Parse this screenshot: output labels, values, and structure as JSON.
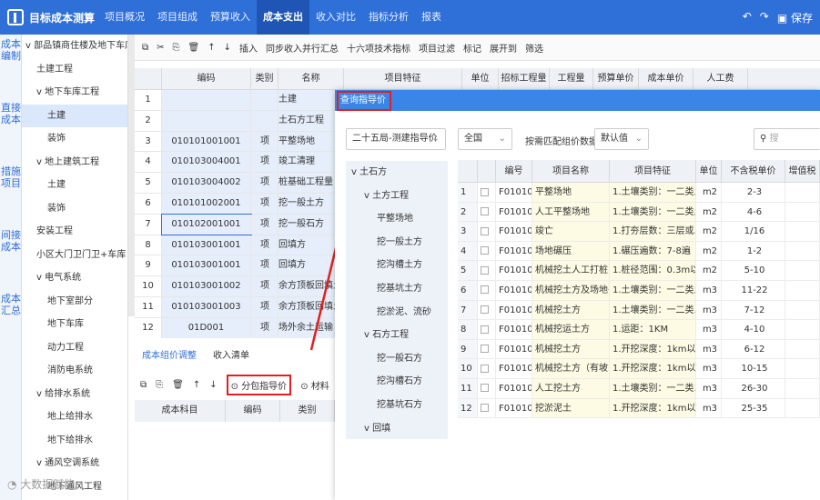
{
  "app": {
    "title": "目标成本测算"
  },
  "menu": [
    "项目概况",
    "项目组成",
    "预算收入",
    "成本支出",
    "收入对比",
    "指标分析",
    "报表"
  ],
  "menu_active": 3,
  "top_icons": [
    "undo-icon",
    "redo-icon",
    "save-icon"
  ],
  "save_label": "保存",
  "side_tabs": [
    "成本编制",
    "直接成本",
    "措施项目",
    "间接成本",
    "成本汇总"
  ],
  "tree": [
    {
      "label": "部品镇商住楼及地下车库",
      "indent": 0,
      "caret": "v"
    },
    {
      "label": "土建工程",
      "indent": 1,
      "caret": ""
    },
    {
      "label": "地下车库工程",
      "indent": 1,
      "caret": "v"
    },
    {
      "label": "土建",
      "indent": 2,
      "caret": "",
      "sel": true
    },
    {
      "label": "装饰",
      "indent": 2,
      "caret": ""
    },
    {
      "label": "地上建筑工程",
      "indent": 1,
      "caret": "v"
    },
    {
      "label": "土建",
      "indent": 2,
      "caret": ""
    },
    {
      "label": "装饰",
      "indent": 2,
      "caret": ""
    },
    {
      "label": "安装工程",
      "indent": 1,
      "caret": ""
    },
    {
      "label": "小区大门卫门卫+车库",
      "indent": 1,
      "caret": ""
    },
    {
      "label": "电气系统",
      "indent": 1,
      "caret": "v"
    },
    {
      "label": "地下室部分",
      "indent": 2,
      "caret": ""
    },
    {
      "label": "地下车库",
      "indent": 2,
      "caret": ""
    },
    {
      "label": "动力工程",
      "indent": 2,
      "caret": ""
    },
    {
      "label": "消防电系统",
      "indent": 2,
      "caret": ""
    },
    {
      "label": "给排水系统",
      "indent": 1,
      "caret": "v"
    },
    {
      "label": "地上给排水",
      "indent": 2,
      "caret": ""
    },
    {
      "label": "地下给排水",
      "indent": 2,
      "caret": ""
    },
    {
      "label": "通风空调系统",
      "indent": 1,
      "caret": "v"
    },
    {
      "label": "地下通风工程",
      "indent": 2,
      "caret": ""
    }
  ],
  "toolbar": [
    "插入",
    "同步收入并行汇总",
    "十六项技术指标",
    "项目过滤",
    "标记",
    "展开到",
    "筛选"
  ],
  "grid": {
    "headers": [
      "",
      "编码",
      "类别",
      "名称",
      "项目特征",
      "单位",
      "招标工程量",
      "工程量",
      "预算单价",
      "成本单价",
      "人工费"
    ],
    "rows": [
      {
        "n": "1",
        "code": "",
        "type": "",
        "name": "土建"
      },
      {
        "n": "2",
        "code": "",
        "type": "",
        "name": "土石方工程"
      },
      {
        "n": "3",
        "code": "010101001001",
        "type": "项",
        "name": "平整场地"
      },
      {
        "n": "4",
        "code": "010103004001",
        "type": "项",
        "name": "竣工清理"
      },
      {
        "n": "5",
        "code": "010103004002",
        "type": "项",
        "name": "桩基础工程量"
      },
      {
        "n": "6",
        "code": "010101002001",
        "type": "项",
        "name": "挖一般土方"
      },
      {
        "n": "7",
        "code": "010102001001",
        "type": "项",
        "name": "挖一般石方"
      },
      {
        "n": "8",
        "code": "010103001001",
        "type": "项",
        "name": "回填方"
      },
      {
        "n": "9",
        "code": "010103001001",
        "type": "项",
        "name": "回填方"
      },
      {
        "n": "10",
        "code": "010103001002",
        "type": "项",
        "name": "余方顶板回填土"
      },
      {
        "n": "11",
        "code": "010103001003",
        "type": "项",
        "name": "余方顶板回填土"
      },
      {
        "n": "12",
        "code": "01D001",
        "type": "项",
        "name": "场外余土运输"
      }
    ]
  },
  "bottom_tabs": [
    "成本组价调整",
    "收入清单"
  ],
  "bottom_btn": "分包指导价",
  "bottom_btn2": "材料",
  "bottom_headers": [
    "成本科目",
    "编码",
    "类别"
  ],
  "dialog": {
    "title": "查询指导价",
    "source": "二十五局-测建指导价",
    "scope": "全国",
    "filter_label": "按需匹配组价数据",
    "filter_value": "默认值",
    "search_placeholder": "搜",
    "tree": [
      {
        "label": "土石方",
        "indent": 0,
        "caret": "v"
      },
      {
        "label": "土方工程",
        "indent": 1,
        "caret": "v"
      },
      {
        "label": "平整场地",
        "indent": 2,
        "caret": ""
      },
      {
        "label": "挖一般土方",
        "indent": 2,
        "caret": ""
      },
      {
        "label": "挖沟槽土方",
        "indent": 2,
        "caret": ""
      },
      {
        "label": "挖基坑土方",
        "indent": 2,
        "caret": ""
      },
      {
        "label": "挖淤泥、流砂",
        "indent": 2,
        "caret": ""
      },
      {
        "label": "石方工程",
        "indent": 1,
        "caret": "v"
      },
      {
        "label": "挖一般石方",
        "indent": 2,
        "caret": ""
      },
      {
        "label": "挖沟槽石方",
        "indent": 2,
        "caret": ""
      },
      {
        "label": "挖基坑石方",
        "indent": 2,
        "caret": ""
      },
      {
        "label": "回填",
        "indent": 1,
        "caret": "v"
      }
    ],
    "headers": [
      "",
      "",
      "编号",
      "项目名称",
      "项目特征",
      "单位",
      "不含税单价",
      "增值税"
    ],
    "rows": [
      {
        "n": "1",
        "code": "F0101010...",
        "name": "平整场地",
        "feat": "1.土壤类别：一二类土...",
        "unit": "m2",
        "price": "2-3"
      },
      {
        "n": "2",
        "code": "F0101010...",
        "name": "人工平整场地",
        "feat": "1.土壤类别：一二类土...",
        "unit": "m2",
        "price": "4-6"
      },
      {
        "n": "3",
        "code": "F0101010...",
        "name": "竣亡",
        "feat": "1.打夯层数：三层或...",
        "unit": "m2",
        "price": "1/16"
      },
      {
        "n": "4",
        "code": "F0101010...",
        "name": "场地碾压",
        "feat": "1.碾压遍数：7-8遍",
        "unit": "m2",
        "price": "1-2"
      },
      {
        "n": "5",
        "code": "F0101010...",
        "name": "机械挖土人工打桩",
        "feat": "1.桩径范围：0.3m以上...",
        "unit": "m2",
        "price": "5-10"
      },
      {
        "n": "6",
        "code": "F0101010...",
        "name": "机械挖土方及场地平",
        "feat": "1.土壤类别：一二类土...",
        "unit": "m3",
        "price": "11-22"
      },
      {
        "n": "7",
        "code": "F0101010...",
        "name": "机械挖土方",
        "feat": "1.土壤类别：一二类...",
        "unit": "m3",
        "price": "7-12"
      },
      {
        "n": "8",
        "code": "F0101010...",
        "name": "机械挖运土方",
        "feat": "1.运距：1KM",
        "unit": "m3",
        "price": "4-10"
      },
      {
        "n": "9",
        "code": "F0101010...",
        "name": "机械挖土方",
        "feat": "1.开挖深度：1km以内...",
        "unit": "m3",
        "price": "6-12"
      },
      {
        "n": "10",
        "code": "F0101010...",
        "name": "机械挖土方（有坡...",
        "feat": "1.开挖深度：1km以内...",
        "unit": "m3",
        "price": "10-15"
      },
      {
        "n": "11",
        "code": "F0101010...",
        "name": "人工挖土方",
        "feat": "1.土壤类别：一二类...",
        "unit": "m3",
        "price": "26-30"
      },
      {
        "n": "12",
        "code": "F0101010...",
        "name": "挖淤泥土",
        "feat": "1.开挖深度：1km以内...",
        "unit": "m3",
        "price": "25-35"
      }
    ]
  },
  "bottom_logo": "大数据赋能"
}
